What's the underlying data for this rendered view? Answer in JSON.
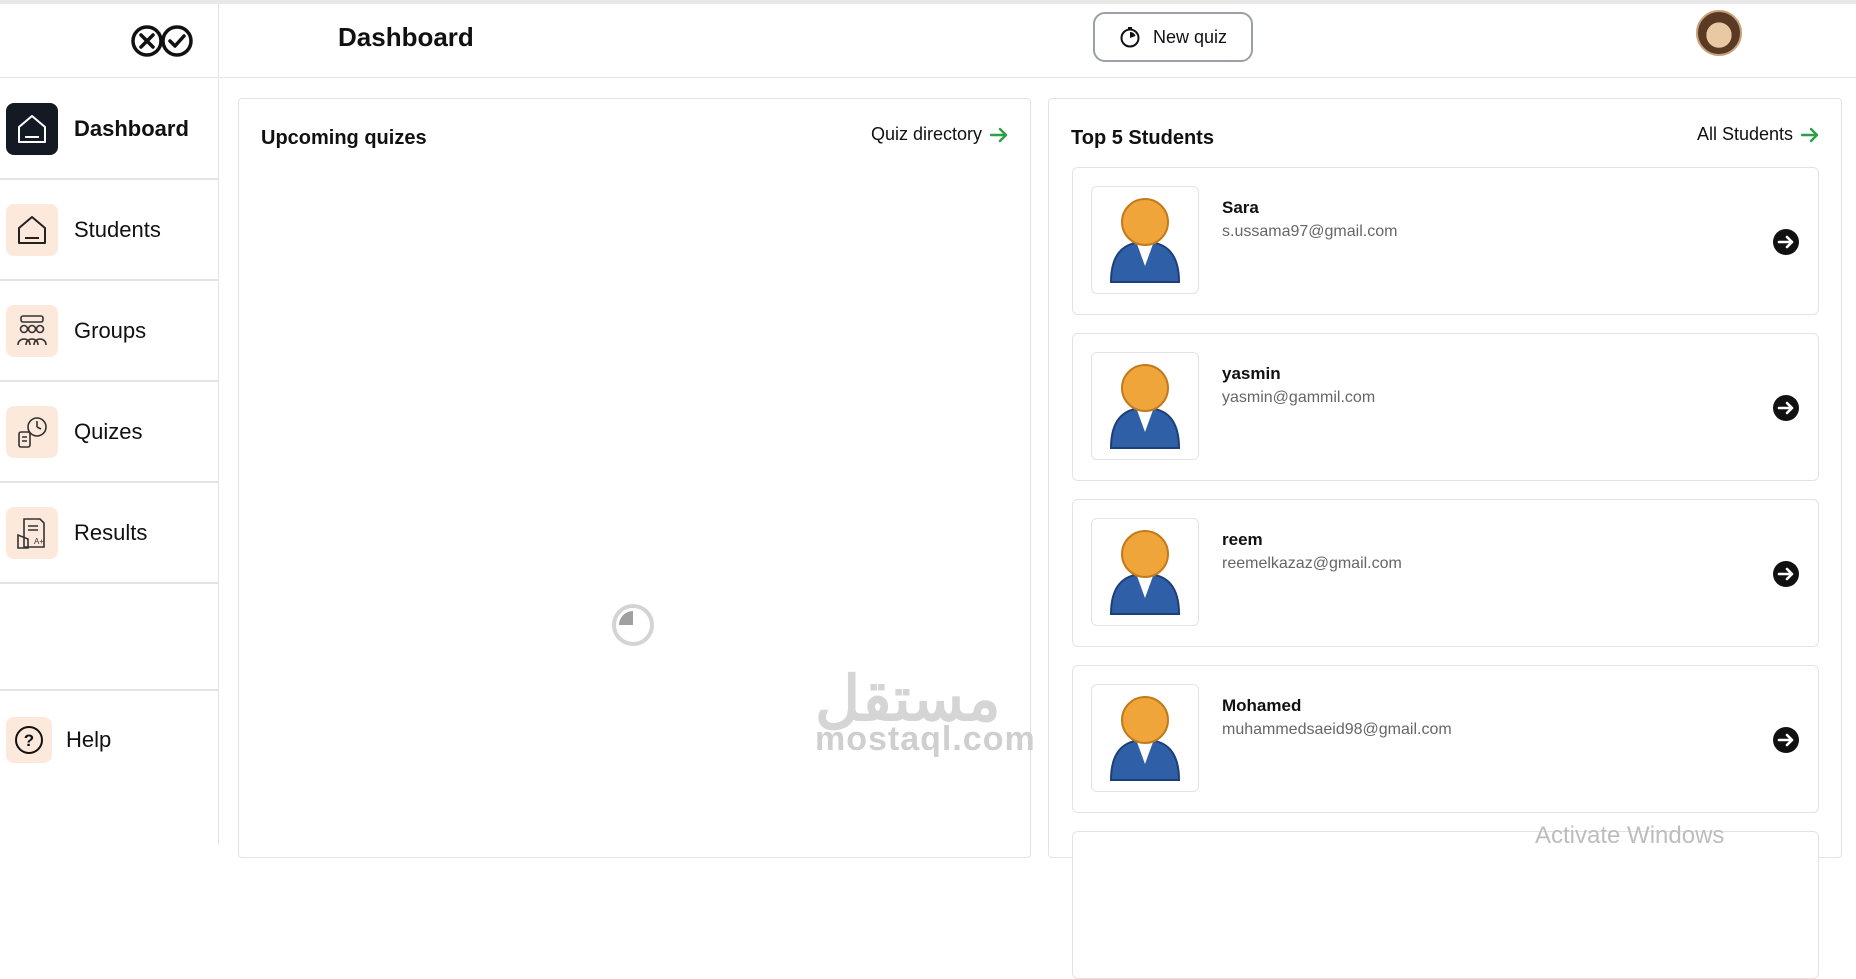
{
  "header": {
    "title": "Dashboard",
    "new_quiz_label": "New quiz"
  },
  "sidebar": {
    "items": [
      {
        "label": "Dashboard",
        "icon": "home-icon",
        "active": true
      },
      {
        "label": "Students",
        "icon": "home-icon",
        "active": false
      },
      {
        "label": "Groups",
        "icon": "group-icon",
        "active": false
      },
      {
        "label": "Quizes",
        "icon": "quiz-icon",
        "active": false
      },
      {
        "label": "Results",
        "icon": "results-icon",
        "active": false
      }
    ],
    "help_label": "Help"
  },
  "upcoming": {
    "title": "Upcoming quizes",
    "link_label": "Quiz directory"
  },
  "top_students": {
    "title": "Top 5 Students",
    "link_label": "All Students",
    "students": [
      {
        "name": "Sara",
        "email": "s.ussama97@gmail.com"
      },
      {
        "name": "yasmin",
        "email": "yasmin@gammil.com"
      },
      {
        "name": "reem",
        "email": "reemelkazaz@gmail.com"
      },
      {
        "name": "Mohamed",
        "email": "muhammedsaeid98@gmail.com"
      }
    ]
  },
  "watermark": {
    "arabic": "مستقل",
    "latin": "mostaql.com"
  },
  "overlay": {
    "activate_text": "Activate Windows"
  },
  "colors": {
    "accent_green": "#2e9e4a",
    "active_nav_bg": "#141a24",
    "nav_icon_bg": "#fde9dc"
  }
}
